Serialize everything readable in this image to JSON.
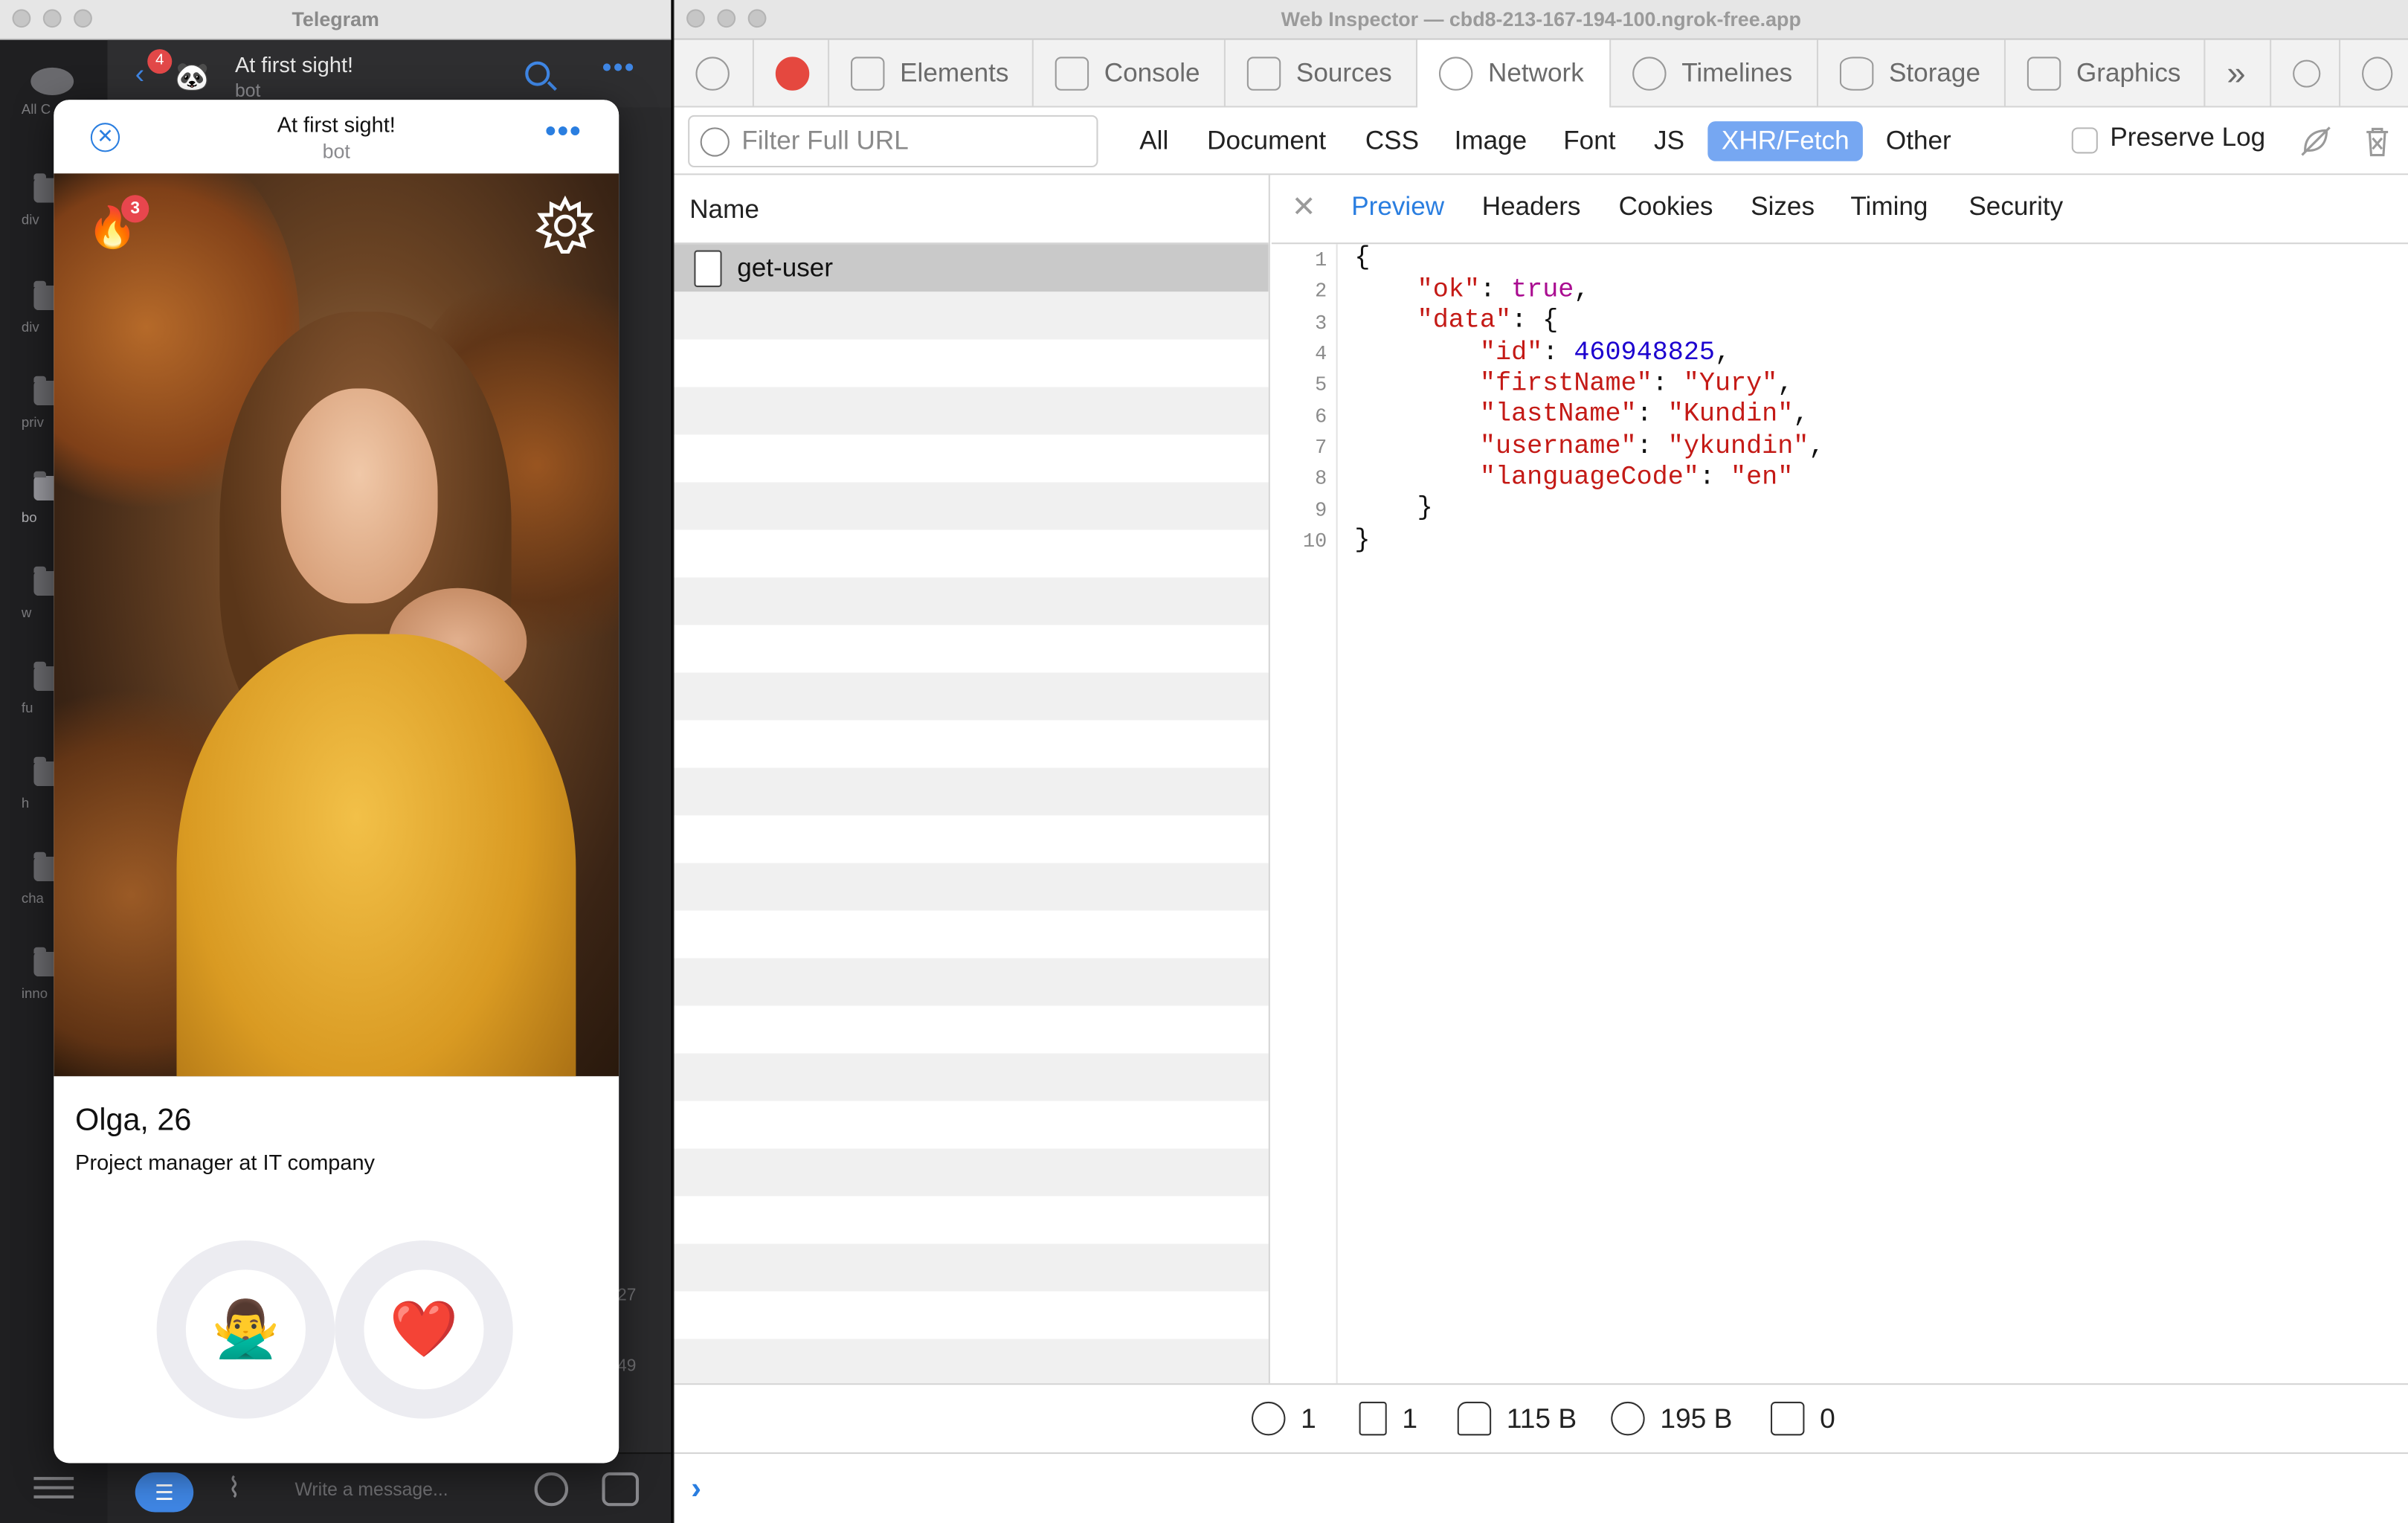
{
  "telegram": {
    "window_title": "Telegram",
    "sidebar": {
      "items": [
        {
          "label": "All C"
        },
        {
          "label": "div"
        },
        {
          "label": "div"
        },
        {
          "label": "priv"
        },
        {
          "label": "bo"
        },
        {
          "label": "w"
        },
        {
          "label": "fu"
        },
        {
          "label": "h"
        },
        {
          "label": "cha"
        },
        {
          "label": "inno"
        }
      ]
    },
    "chat": {
      "unread_count": "4",
      "title": "At first sight!",
      "subtitle": "bot",
      "times": [
        "27",
        "49"
      ],
      "compose_placeholder": "Write a message..."
    }
  },
  "mini_app": {
    "title": "At first sight!",
    "subtitle": "bot",
    "close_glyph": "✕",
    "more_glyph": "•••",
    "fire_glyph": "🔥",
    "fire_count": "3",
    "profile": {
      "name_age": "Olga, 26",
      "job": "Project manager at IT company"
    },
    "actions": {
      "dislike_emoji": "🙅‍♂️",
      "like_emoji": "❤️"
    }
  },
  "inspector": {
    "window_title": "Web Inspector — cbd8-213-167-194-100.ngrok-free.app",
    "tabs": [
      {
        "label": "Elements",
        "icon": "elements-icon"
      },
      {
        "label": "Console",
        "icon": "console-icon"
      },
      {
        "label": "Sources",
        "icon": "sources-icon"
      },
      {
        "label": "Network",
        "icon": "network-icon",
        "active": true
      },
      {
        "label": "Timelines",
        "icon": "timelines-icon"
      },
      {
        "label": "Storage",
        "icon": "storage-icon"
      },
      {
        "label": "Graphics",
        "icon": "graphics-icon"
      }
    ],
    "overflow_glyph": "»",
    "filter": {
      "placeholder": "Filter Full URL",
      "types": [
        "All",
        "Document",
        "CSS",
        "Image",
        "Font",
        "JS",
        "XHR/Fetch",
        "Other"
      ],
      "active_type": "XHR/Fetch",
      "preserve_log": "Preserve Log",
      "preserve_checked": false
    },
    "list": {
      "column_name": "Name",
      "rows": [
        {
          "name": "get-user",
          "selected": true
        }
      ]
    },
    "detail": {
      "tabs": [
        "Preview",
        "Headers",
        "Cookies",
        "Sizes",
        "Timing",
        "Security"
      ],
      "active_tab": "Preview",
      "line_numbers": [
        "1",
        "2",
        "3",
        "4",
        "5",
        "6",
        "7",
        "8",
        "9",
        "10"
      ],
      "json": {
        "ok_key": "\"ok\"",
        "ok_value": "true",
        "data_key": "\"data\"",
        "id_key": "\"id\"",
        "id_value": "460948825",
        "firstName_key": "\"firstName\"",
        "firstName_value": "\"Yury\"",
        "lastName_key": "\"lastName\"",
        "lastName_value": "\"Kundin\"",
        "username_key": "\"username\"",
        "username_value": "\"ykundin\"",
        "languageCode_key": "\"languageCode\"",
        "languageCode_value": "\"en\""
      }
    },
    "status": {
      "domains": "1",
      "resources": "1",
      "transferred": "115 B",
      "size": "195 B",
      "errors": "0"
    }
  },
  "colors": {
    "accent": "#2a7ee0",
    "active_filter": "#76a7f2",
    "json_key": "#c41a16",
    "json_number": "#1c00cf",
    "json_bool": "#aa0d91",
    "badge": "#e8464d"
  }
}
